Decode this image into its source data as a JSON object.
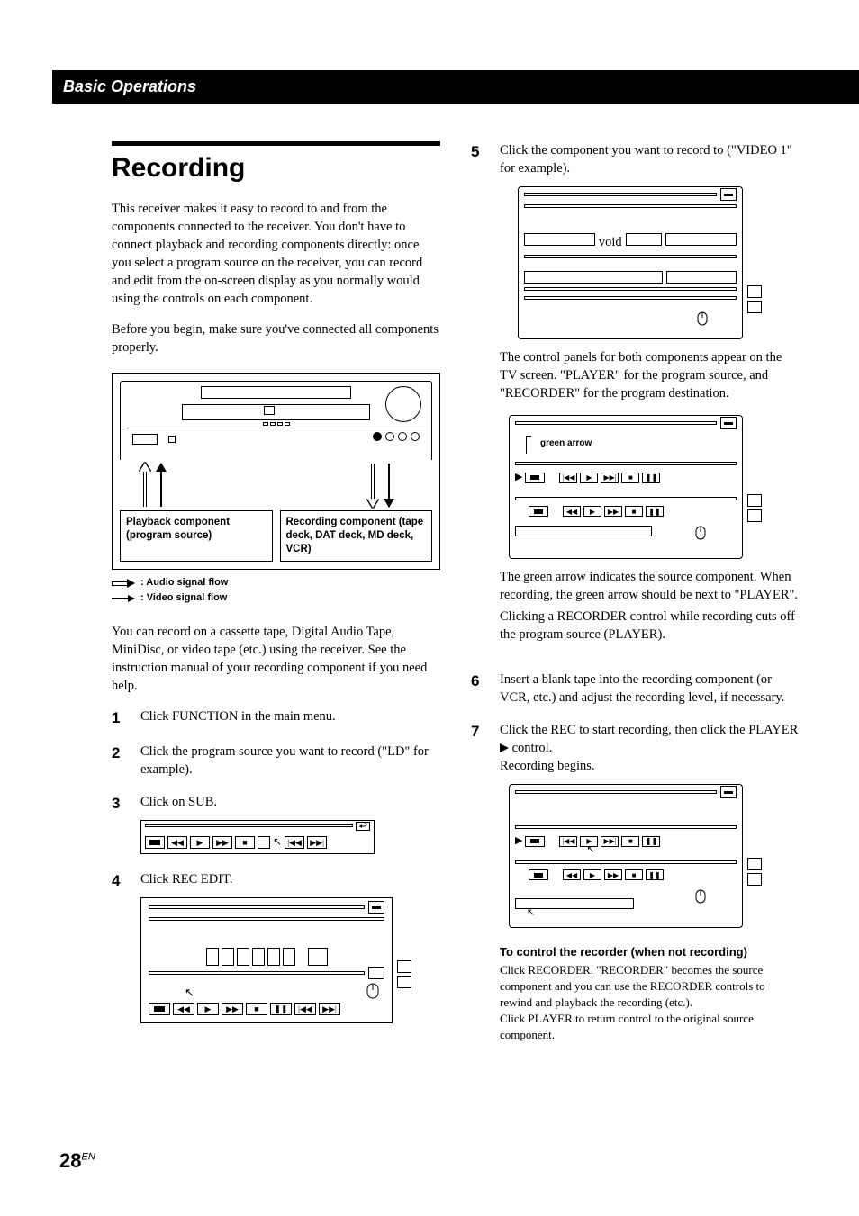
{
  "section_header": "Basic Operations",
  "title": "Recording",
  "intro_p1": "This receiver makes it easy to record to and from the components connected to the receiver.  You don't have to connect playback and recording components directly: once you select a program source on the receiver, you can record and edit from the on-screen display as you normally would using the controls on each component.",
  "intro_p2": "Before you begin, make sure you've connected all components properly.",
  "playback_label": "Playback component (program source)",
  "recording_label": "Recording component (tape deck, DAT deck, MD deck, VCR)",
  "audio_flow": ": Audio signal flow",
  "video_flow": ": Video signal flow",
  "after_diagram": "You can record on a cassette tape, Digital Audio Tape, MiniDisc, or video tape (etc.) using the receiver. See the instruction manual of your  recording component if you need help.",
  "steps": {
    "s1": "Click FUNCTION in the main menu.",
    "s2": "Click the program source you want to record (\"LD\" for example).",
    "s3": "Click on SUB.",
    "s4": "Click REC EDIT.",
    "s5": "Click the component you want to record to (\"VIDEO 1\" for example).",
    "s5_after": "The control panels for both components appear on the TV screen. \"PLAYER\" for the program source, and \"RECORDER\" for the program destination.",
    "green_arrow_label": "green arrow",
    "s5_after2a": "The green arrow indicates the source component. When recording, the green arrow should be next to \"PLAYER\".",
    "s5_after2b": "Clicking a RECORDER control while recording cuts off the program source (PLAYER).",
    "s6": "Insert a blank tape into the recording component (or VCR, etc.) and adjust the recording level, if necessary.",
    "s7a": "Click the REC to start recording, then click the PLAYER ",
    "s7b": " control.",
    "s7c": "Recording begins."
  },
  "footer_head": "To control the recorder (when not recording)",
  "footer_body": "Click RECORDER. \"RECORDER\" becomes the source component and you can use the RECORDER controls to rewind and playback the recording (etc.).\nClick PLAYER to return control to the original source component.",
  "page_num": "28",
  "page_lang": "EN"
}
